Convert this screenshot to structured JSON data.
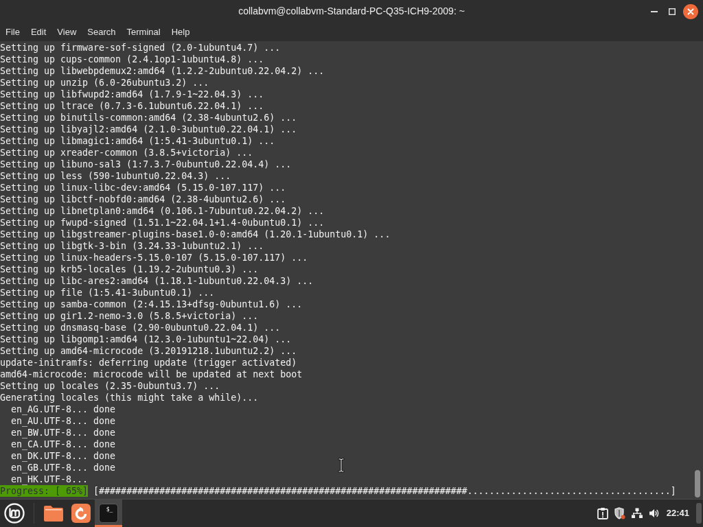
{
  "window": {
    "title": "collabvm@collabvm-Standard-PC-Q35-ICH9-2009: ~"
  },
  "menu": [
    "File",
    "Edit",
    "View",
    "Search",
    "Terminal",
    "Help"
  ],
  "terminal": {
    "lines": [
      "Setting up firmware-sof-signed (2.0-1ubuntu4.7) ...",
      "Setting up cups-common (2.4.1op1-1ubuntu4.8) ...",
      "Setting up libwebpdemux2:amd64 (1.2.2-2ubuntu0.22.04.2) ...",
      "Setting up unzip (6.0-26ubuntu3.2) ...",
      "Setting up libfwupd2:amd64 (1.7.9-1~22.04.3) ...",
      "Setting up ltrace (0.7.3-6.1ubuntu6.22.04.1) ...",
      "Setting up binutils-common:amd64 (2.38-4ubuntu2.6) ...",
      "Setting up libyajl2:amd64 (2.1.0-3ubuntu0.22.04.1) ...",
      "Setting up libmagic1:amd64 (1:5.41-3ubuntu0.1) ...",
      "Setting up xreader-common (3.8.5+victoria) ...",
      "Setting up libuno-sal3 (1:7.3.7-0ubuntu0.22.04.4) ...",
      "Setting up less (590-1ubuntu0.22.04.3) ...",
      "Setting up linux-libc-dev:amd64 (5.15.0-107.117) ...",
      "Setting up libctf-nobfd0:amd64 (2.38-4ubuntu2.6) ...",
      "Setting up libnetplan0:amd64 (0.106.1-7ubuntu0.22.04.2) ...",
      "Setting up fwupd-signed (1.51.1~22.04.1+1.4-0ubuntu0.1) ...",
      "Setting up libgstreamer-plugins-base1.0-0:amd64 (1.20.1-1ubuntu0.1) ...",
      "Setting up libgtk-3-bin (3.24.33-1ubuntu2.1) ...",
      "Setting up linux-headers-5.15.0-107 (5.15.0-107.117) ...",
      "Setting up krb5-locales (1.19.2-2ubuntu0.3) ...",
      "Setting up libc-ares2:amd64 (1.18.1-1ubuntu0.22.04.3) ...",
      "Setting up file (1:5.41-3ubuntu0.1) ...",
      "Setting up samba-common (2:4.15.13+dfsg-0ubuntu1.6) ...",
      "Setting up gir1.2-nemo-3.0 (5.8.5+victoria) ...",
      "Setting up dnsmasq-base (2.90-0ubuntu0.22.04.1) ...",
      "Setting up libgomp1:amd64 (12.3.0-1ubuntu1~22.04) ...",
      "Setting up amd64-microcode (3.20191218.1ubuntu2.2) ...",
      "update-initramfs: deferring update (trigger activated)",
      "amd64-microcode: microcode will be updated at next boot",
      "Setting up locales (2.35-0ubuntu3.7) ...",
      "Generating locales (this might take a while)...",
      "  en_AG.UTF-8... done",
      "  en_AU.UTF-8... done",
      "  en_BW.UTF-8... done",
      "  en_CA.UTF-8... done",
      "  en_DK.UTF-8... done",
      "  en_GB.UTF-8... done",
      "  en_HK.UTF-8..."
    ],
    "progress": {
      "label": "Progress: [ 65%]",
      "bar": "[###################################################################.....................................]"
    }
  },
  "taskbar": {
    "launchers": [
      {
        "kind": "folder",
        "selected": false
      },
      {
        "kind": "browser",
        "selected": false
      },
      {
        "kind": "terminal",
        "selected": true,
        "glyph": "$_"
      }
    ],
    "clock": "22:41"
  }
}
